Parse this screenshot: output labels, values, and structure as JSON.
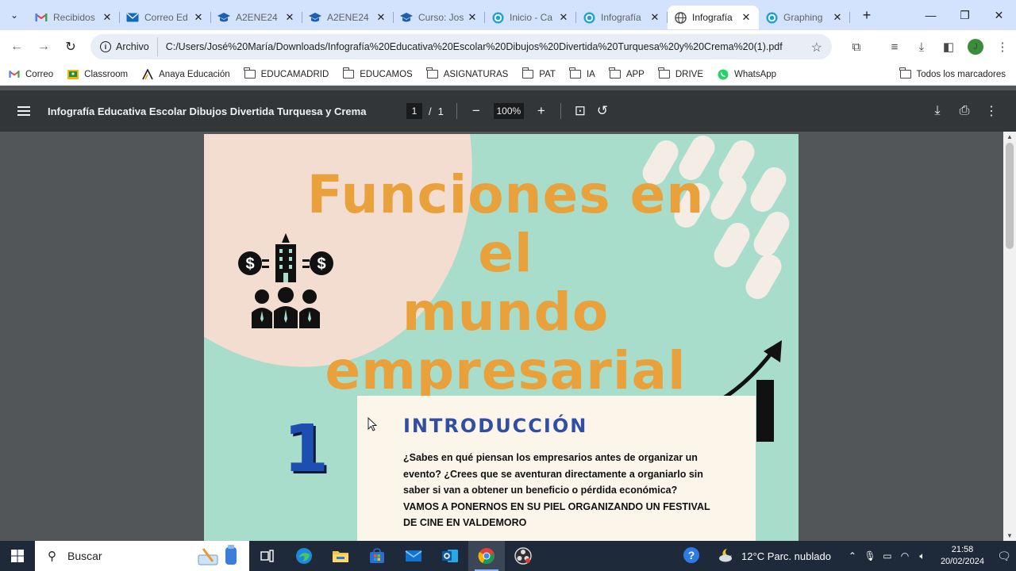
{
  "tabs": [
    {
      "title": "Recibidos",
      "icon": "gmail-icon",
      "active": false
    },
    {
      "title": "Correo Ed",
      "icon": "outlook-mail-icon",
      "active": false
    },
    {
      "title": "A2ENE24",
      "icon": "graduation-cap-icon",
      "active": false
    },
    {
      "title": "A2ENE24",
      "icon": "graduation-cap-icon",
      "active": false
    },
    {
      "title": "Curso: Jos",
      "icon": "graduation-cap-icon",
      "active": false
    },
    {
      "title": "Inicio - Ca",
      "icon": "canva-icon",
      "active": false
    },
    {
      "title": "Infografía",
      "icon": "canva-icon",
      "active": false
    },
    {
      "title": "Infografía",
      "icon": "globe-icon",
      "active": true
    },
    {
      "title": "Graphing",
      "icon": "canva-icon",
      "active": false
    }
  ],
  "toolbar": {
    "chip_label": "Archivo",
    "url": "C:/Users/José%20María/Downloads/Infografía%20Educativa%20Escolar%20Dibujos%20Divertida%20Turquesa%20y%20Crema%20(1).pdf",
    "avatar_letter": "J"
  },
  "bookmarks": [
    {
      "label": "Correo",
      "icon": "gmail-icon"
    },
    {
      "label": "Classroom",
      "icon": "classroom-icon"
    },
    {
      "label": "Anaya Educación",
      "icon": "anaya-icon"
    },
    {
      "label": "EDUCAMADRID",
      "icon": "folder-icon"
    },
    {
      "label": "EDUCAMOS",
      "icon": "folder-icon"
    },
    {
      "label": "ASIGNATURAS",
      "icon": "folder-icon"
    },
    {
      "label": "PAT",
      "icon": "folder-icon"
    },
    {
      "label": "IA",
      "icon": "folder-icon"
    },
    {
      "label": "APP",
      "icon": "folder-icon"
    },
    {
      "label": "DRIVE",
      "icon": "folder-icon"
    },
    {
      "label": "WhatsApp",
      "icon": "whatsapp-icon"
    }
  ],
  "bookmarks_all": "Todos los marcadores",
  "pdf": {
    "title": "Infografía Educativa Escolar Dibujos Divertida Turquesa y Crema",
    "current_page": "1",
    "page_separator": "/",
    "total_pages": "1",
    "zoom": "100%"
  },
  "document": {
    "headline_line1": "Funciones en el",
    "headline_line2": "mundo",
    "headline_line3": "empresarial",
    "section_number": "1",
    "section_title": "INTRODUCCIÓN",
    "section_text": "¿Sabes en qué piensan los empresarios antes de organizar un evento? ¿Crees que se aventuran directamente a organiarlo sin saber si van a obtener un beneficio o pérdida económica? VAMOS A PONERNOS EN SU PIEL ORGANIZANDO UN FESTIVAL DE CINE EN VALDEMORO",
    "colors": {
      "background": "#a8dccb",
      "blob": "#f3ddd0",
      "headline": "#e9a13b",
      "title": "#2f4ea4",
      "card": "#fbf5ea"
    }
  },
  "taskbar": {
    "search_placeholder": "Buscar",
    "weather": "12°C  Parc. nublado",
    "time": "21:58",
    "date": "20/02/2024"
  }
}
